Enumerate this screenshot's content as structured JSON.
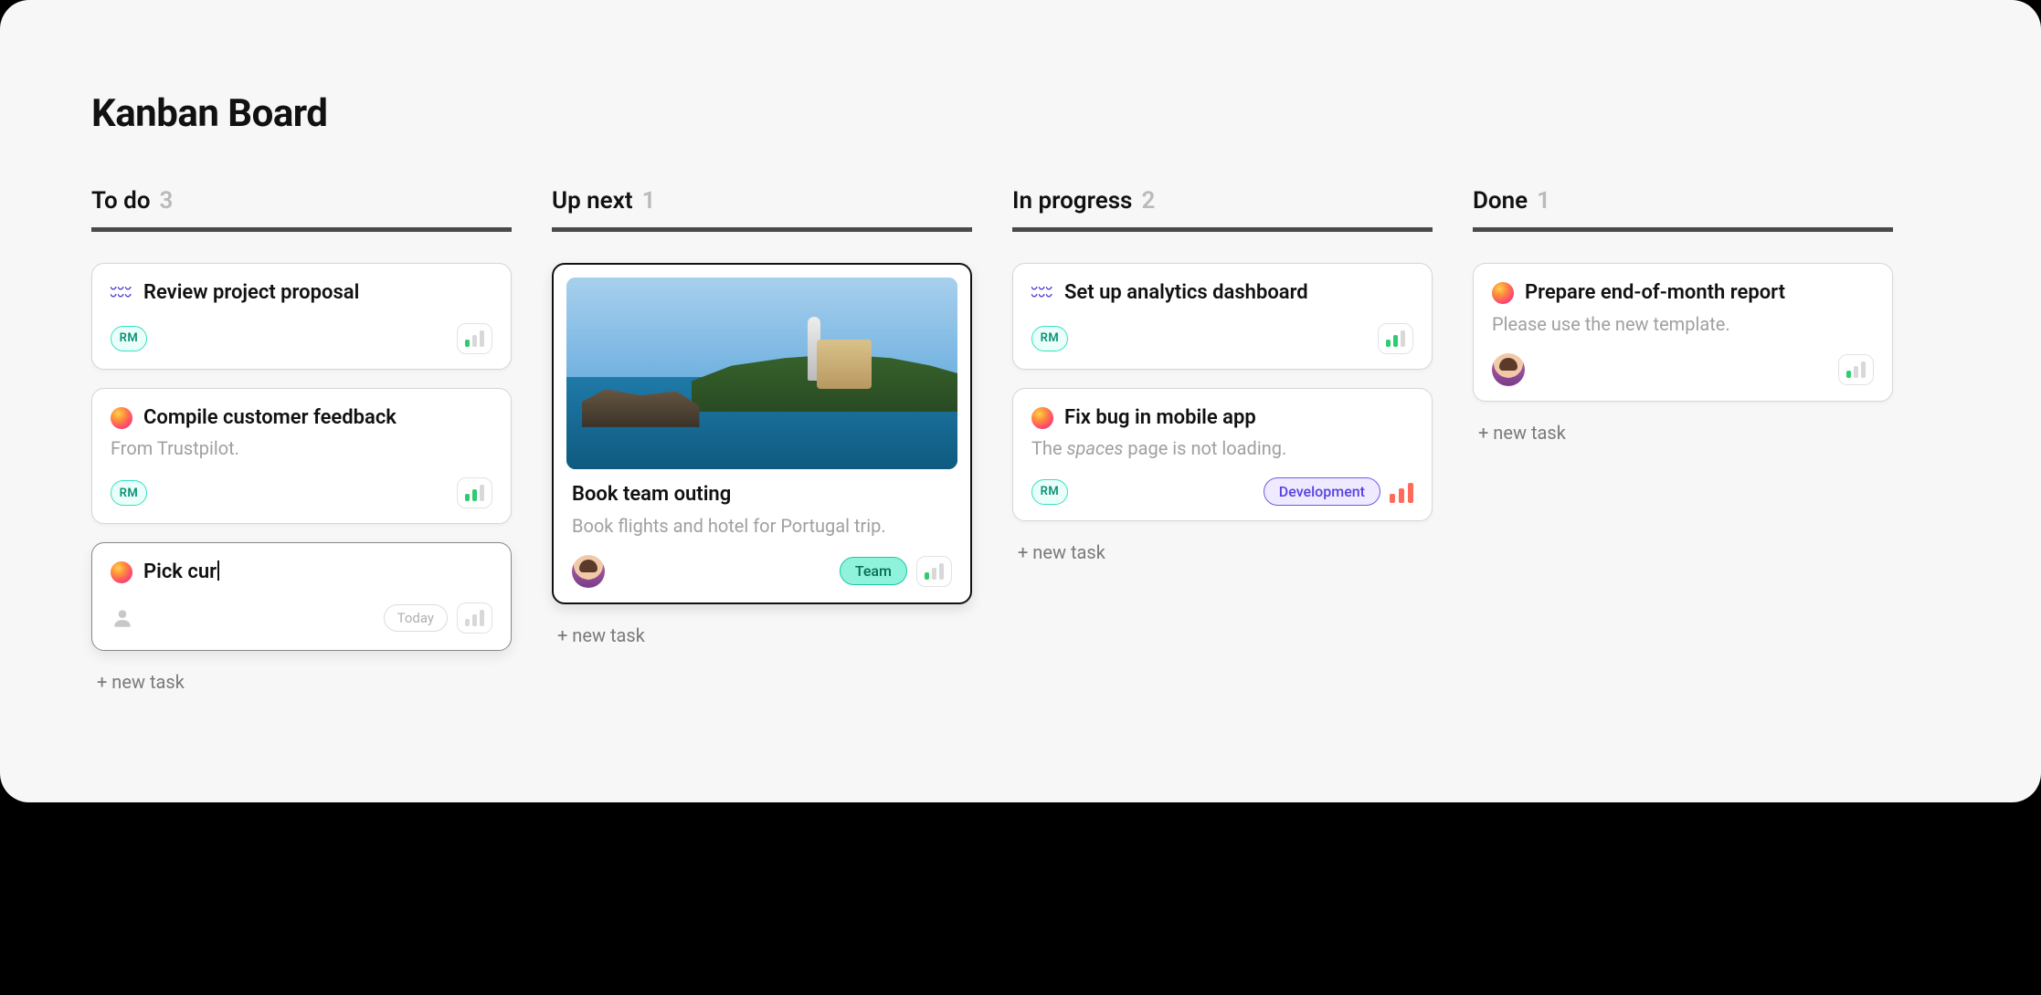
{
  "page_title": "Kanban Board",
  "new_task_label": "+ new task",
  "columns": [
    {
      "title": "To do",
      "count": "3",
      "cards": [
        {
          "icon": "wave",
          "title": "Review project proposal",
          "assignee": {
            "type": "initials",
            "value": "RM"
          },
          "priority": "low"
        },
        {
          "icon": "gradient",
          "title": "Compile customer feedback",
          "description": "From Trustpilot.",
          "assignee": {
            "type": "initials",
            "value": "RM"
          },
          "priority": "med"
        },
        {
          "icon": "gradient",
          "title": "Pick cur",
          "editing": true,
          "assignee": {
            "type": "empty"
          },
          "date_chip": "Today",
          "priority": "ghost"
        }
      ]
    },
    {
      "title": "Up next",
      "count": "1",
      "cards": [
        {
          "selected": true,
          "cover": true,
          "title": "Book team outing",
          "description": "Book flights and hotel for Portugal trip.",
          "assignee": {
            "type": "avatar"
          },
          "tag": {
            "label": "Team",
            "style": "team"
          },
          "priority": "low"
        }
      ]
    },
    {
      "title": "In progress",
      "count": "2",
      "cards": [
        {
          "icon": "wave",
          "title": "Set up analytics dashboard",
          "assignee": {
            "type": "initials",
            "value": "RM"
          },
          "priority": "med"
        },
        {
          "icon": "gradient",
          "title": "Fix bug in mobile app",
          "description_html": "The <em>spaces</em> page is not loading.",
          "assignee": {
            "type": "initials",
            "value": "RM"
          },
          "tag": {
            "label": "Development",
            "style": "dev"
          },
          "priority_bare": "high"
        }
      ]
    },
    {
      "title": "Done",
      "count": "1",
      "cards": [
        {
          "icon": "gradient",
          "title": "Prepare end-of-month report",
          "description": "Please use the new template.",
          "assignee": {
            "type": "avatar"
          },
          "priority": "low"
        }
      ]
    }
  ]
}
